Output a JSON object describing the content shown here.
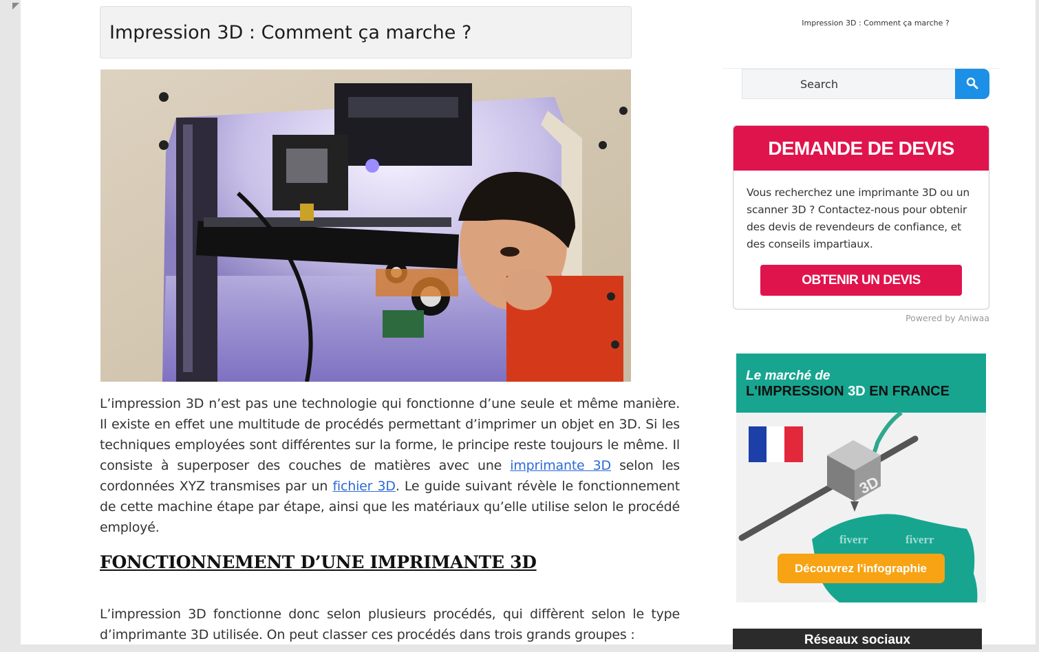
{
  "article": {
    "title": "Impression 3D : Comment ça marche ?",
    "hero_alt": "Enfant regardant une imprimante 3D en fonctionnement",
    "intro": {
      "part1": "L’impression 3D n’est pas une technologie qui fonctionne d’une seule et même manière. Il existe en effet une multitude de procédés permettant d’imprimer un objet en 3D. Si les techniques employées sont différentes sur la forme, le principe reste toujours le même. Il consiste à superposer des couches de matières avec une ",
      "link1": "imprimante 3D",
      "part2": " selon les cordonnées XYZ transmises par un ",
      "link2": "fichier 3D",
      "part3": ". Le guide suivant révèle le fonctionnement de cette machine étape par étape, ainsi que les matériaux qu’elle utilise selon le procédé employé."
    },
    "section_heading": "FONCTIONNEMENT D’UNE IMPRIMANTE 3D",
    "paragraph2": "L’impression 3D fonctionne donc selon plusieurs procédés, qui diffèrent selon le type d’imprimante 3D utilisée. On peut classer ces procédés dans trois grands groupes :"
  },
  "sidebar": {
    "page_title": "Impression 3D : Comment ça marche ?",
    "search": {
      "placeholder": "Search",
      "icon": "search-icon"
    },
    "devis": {
      "header": "DEMANDE DE DEVIS",
      "text": "Vous recherchez une imprimante 3D ou un scanner 3D ? Contactez-nous pour obtenir des devis de revendeurs de confiance, et des conseils impartiaux.",
      "button": "OBTENIR UN DEVIS",
      "powered_by": "Powered by Aniwaa"
    },
    "infographic": {
      "line1": "Le marché de",
      "line2a": "L'IMPRESSION ",
      "line2b": "3D",
      "line2c": " EN FRANCE",
      "cube_label": "3D",
      "watermark": "fiverr",
      "button": "Découvrez l'infographie"
    },
    "social_title": "Réseaux sociaux"
  },
  "colors": {
    "accent_red": "#e0144c",
    "search_blue": "#1c8fe6",
    "link_blue": "#2b6ad6",
    "infographic_teal": "#17a590",
    "infographic_orange": "#f7a313"
  }
}
